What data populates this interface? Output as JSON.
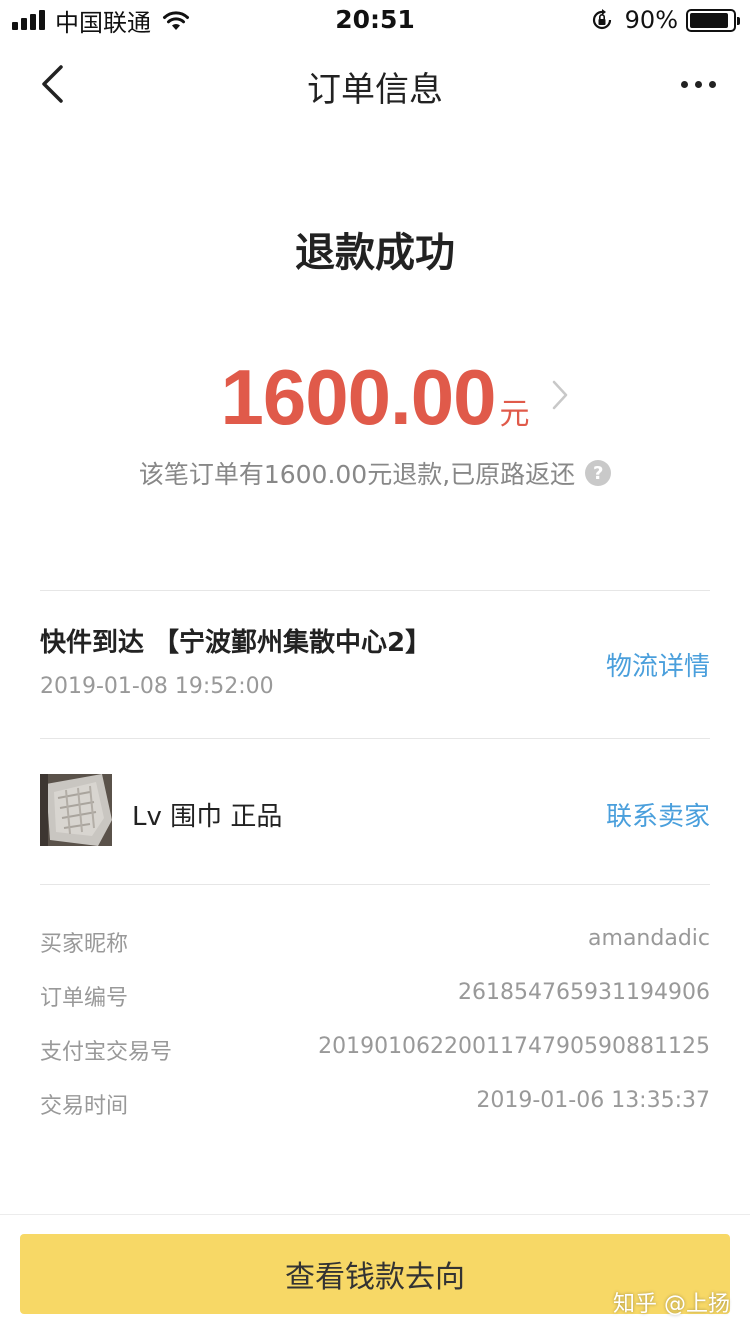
{
  "status_bar": {
    "carrier": "中国联通",
    "time": "20:51",
    "battery_percent": "90%",
    "battery_level": 0.9,
    "signal_bars": 4,
    "icons": [
      "signal-icon",
      "wifi-icon",
      "orientation-lock-icon",
      "battery-icon"
    ]
  },
  "nav": {
    "title": "订单信息",
    "back_icon": "chevron-left-icon",
    "more_icon": "more-dots-icon"
  },
  "refund": {
    "status": "退款成功",
    "amount": "1600.00",
    "unit": "元",
    "description": "该笔订单有1600.00元退款,已原路返还",
    "help_icon": "?"
  },
  "logistics": {
    "status": "快件到达 【宁波鄞州集散中心2】",
    "time": "2019-01-08 19:52:00",
    "link": "物流详情"
  },
  "product": {
    "name": "Lv 围巾 正品",
    "contact": "联系卖家"
  },
  "details": [
    {
      "label": "买家昵称",
      "value": "amandadic"
    },
    {
      "label": "订单编号",
      "value": "261854765931194906"
    },
    {
      "label": "支付宝交易号",
      "value": "2019010622001174790590881125"
    },
    {
      "label": "交易时间",
      "value": "2019-01-06 13:35:37"
    }
  ],
  "action": {
    "label": "查看钱款去向"
  },
  "watermark": "知乎 @上扬",
  "colors": {
    "accent_red": "#e05a4a",
    "link_blue": "#4a9fdc",
    "button_yellow": "#f7d866"
  }
}
